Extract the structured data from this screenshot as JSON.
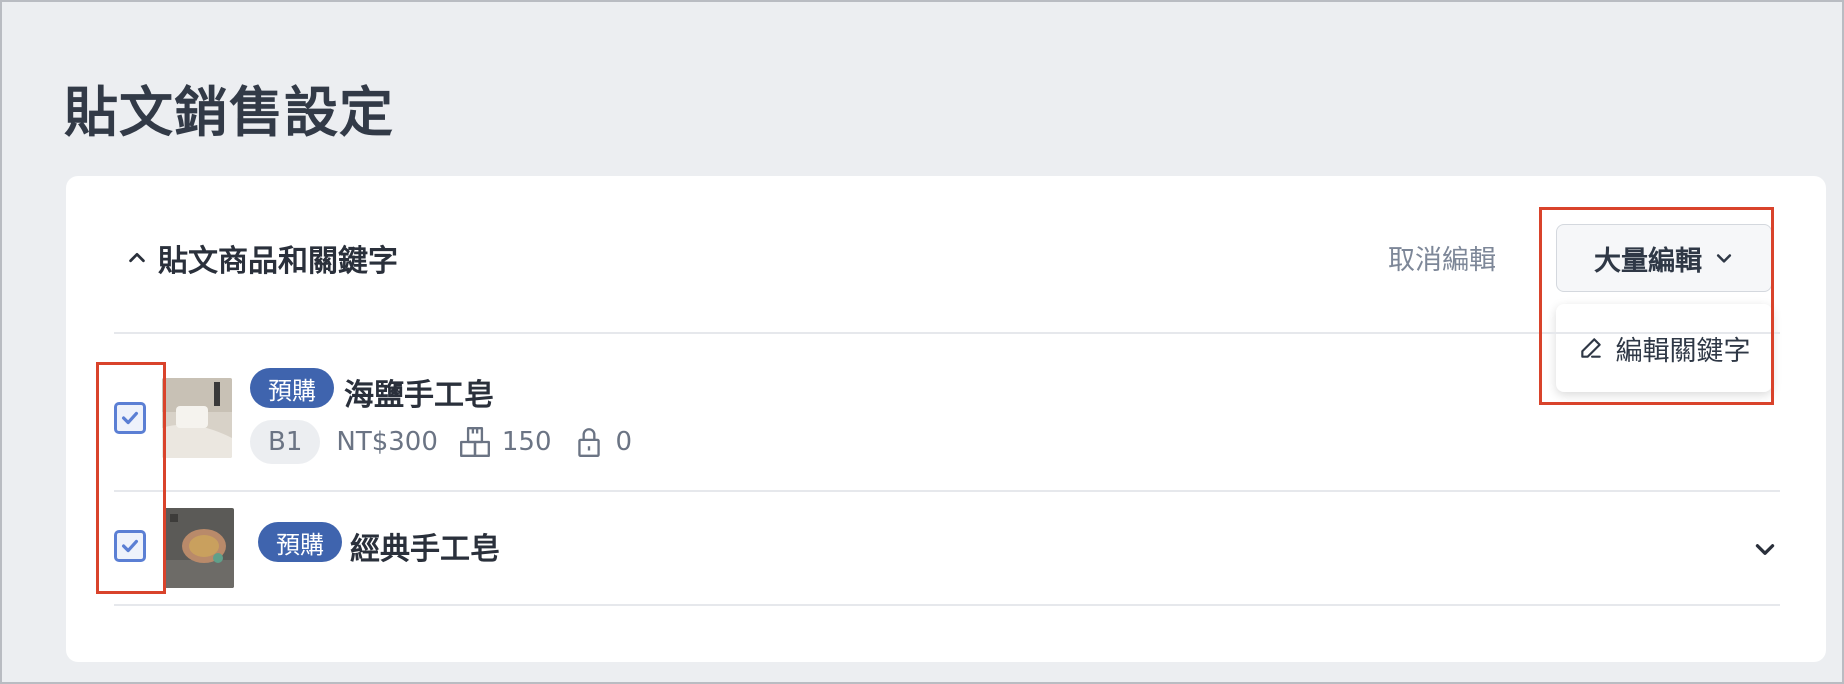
{
  "page": {
    "title": "貼文銷售設定"
  },
  "section": {
    "title": "貼文商品和關鍵字",
    "cancel_label": "取消編輯",
    "bulk_edit_label": "大量編輯",
    "dropdown_item_label": "編輯關鍵字"
  },
  "products": [
    {
      "checked": true,
      "tag": "預購",
      "name": "海鹽手工皂",
      "code": "B1",
      "price": "NT$300",
      "stock": "150",
      "locked": "0"
    },
    {
      "checked": true,
      "tag": "預購",
      "name": "經典手工皂"
    }
  ],
  "colors": {
    "accent": "#3f64ae",
    "checkbox": "#5b7fd4",
    "highlight": "#d9432b"
  }
}
